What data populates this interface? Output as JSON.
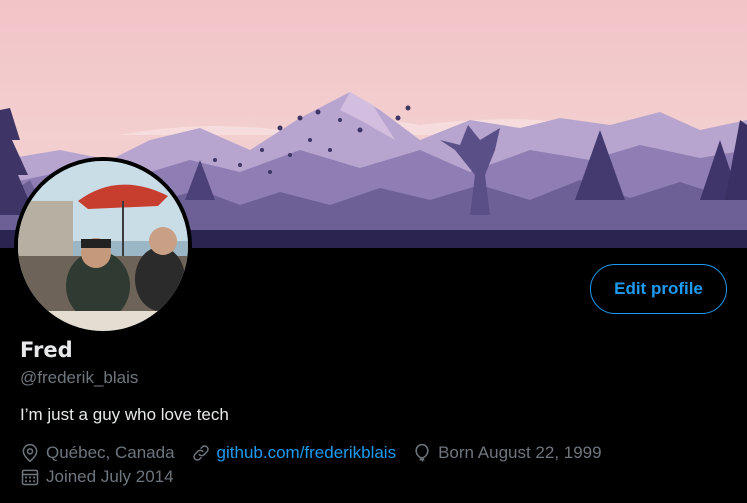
{
  "profile": {
    "name": "Fred",
    "handle": "@frederik_blais",
    "bio": "I’m just a guy who love tech",
    "location": "Québec, Canada",
    "website": "github.com/frederikblais",
    "birthday": "Born August 22, 1999",
    "joined": "Joined July 2014"
  },
  "actions": {
    "edit_profile_label": "Edit profile"
  },
  "icons": {
    "location": "location-pin-icon",
    "website": "link-icon",
    "birthday": "balloon-icon",
    "joined": "calendar-icon"
  },
  "colors": {
    "background": "#000000",
    "accent": "#1d9bf0",
    "muted": "#6e767d",
    "text": "#e7e9ea"
  }
}
